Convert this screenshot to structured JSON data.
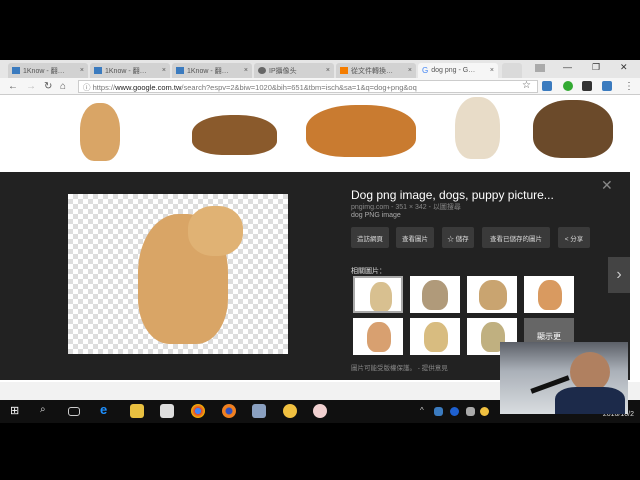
{
  "browser": {
    "tabs": [
      {
        "label": "1Know - 翻…",
        "icon": "1know-icon"
      },
      {
        "label": "1Know - 翻…",
        "icon": "1know-icon"
      },
      {
        "label": "1Know - 翻…",
        "icon": "1know-icon"
      },
      {
        "label": "IP攝像头",
        "icon": "camera-icon"
      },
      {
        "label": "從文件轉換…",
        "icon": "blogger-icon"
      },
      {
        "label": "dog png - G…",
        "icon": "google-icon",
        "active": true
      }
    ],
    "url_prefix": "https://",
    "url_domain": "www.google.com.tw",
    "url_rest": "/search?espv=2&biw=1020&bih=651&tbm=isch&sa=1&q=dog+png&oq"
  },
  "panel": {
    "title": "Dog png image, dogs, puppy picture...",
    "meta": "pngimg.com - 351 × 342 - 以圖搜尋",
    "subtitle": "dog PNG image",
    "buttons": [
      "造訪網頁",
      "查看圖片",
      "☆ 儲存",
      "查看已儲存的圖片",
      "< 分享"
    ],
    "related_label": "相關圖片：",
    "more_label": "顯示更",
    "feedback": "圖片可能受版權保護。 - 提供意見",
    "close": "✕",
    "next": "›"
  },
  "taskbar": {
    "clock": "2016/10/2"
  },
  "colors": {
    "panel_bg": "#222222",
    "taskbar": "#101010",
    "dog": "#d9a566"
  }
}
